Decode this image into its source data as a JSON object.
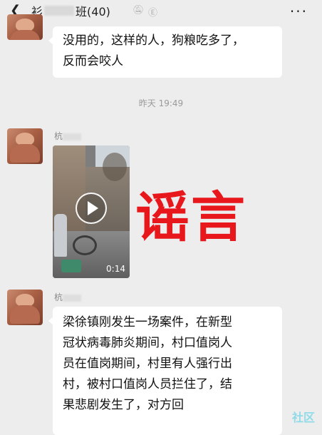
{
  "header": {
    "back_icon": "chevron-left-icon",
    "title_first_char": "衫",
    "title_rest": "班(40)",
    "mute_icon": "bell-off-icon",
    "ear_icon": "earpiece-icon",
    "more_icon": "ellipsis-icon"
  },
  "messages": [
    {
      "lines": [
        "没用的，这样的人，狗粮吃多了，",
        "反而会咬人"
      ]
    }
  ],
  "timestamp": "昨天 19:49",
  "video_message": {
    "sender_name": "杭",
    "duration": "0:14"
  },
  "rumor_stamp": "谣言",
  "text_message": {
    "sender_name": "杭",
    "lines": [
      "梁徐镇刚发生一场案件，在新型",
      "冠状病毒肺炎期间，村口值岗人",
      "员在值岗期间，村里有人强行出",
      "村，被村口值岗人员拦住了，结",
      "果悲剧发生了，对方回"
    ]
  },
  "watermark": "社区"
}
